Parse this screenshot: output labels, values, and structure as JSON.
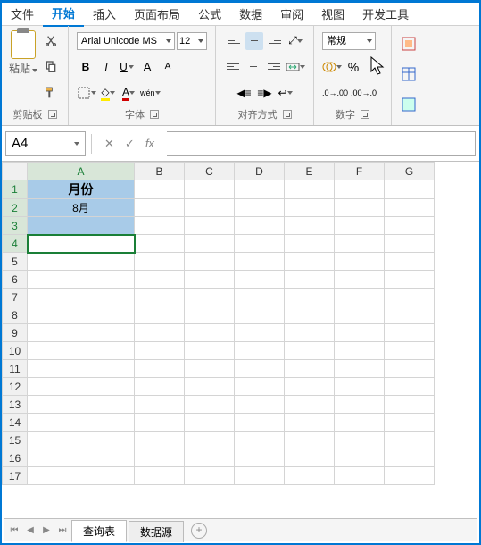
{
  "menu": {
    "items": [
      "文件",
      "开始",
      "插入",
      "页面布局",
      "公式",
      "数据",
      "审阅",
      "视图",
      "开发工具"
    ],
    "active_index": 1
  },
  "ribbon": {
    "clipboard": {
      "paste": "粘贴",
      "label": "剪贴板"
    },
    "font": {
      "name": "Arial Unicode MS",
      "size": "12",
      "bold": "B",
      "italic": "I",
      "underline": "U",
      "grow": "A",
      "shrink": "A",
      "wen": "wén",
      "label": "字体"
    },
    "align": {
      "label": "对齐方式"
    },
    "number": {
      "format": "常规",
      "label": "数字"
    }
  },
  "namebox": "A4",
  "fx": {
    "cancel": "✕",
    "confirm": "✓",
    "fx": "fx"
  },
  "columns": [
    "A",
    "B",
    "C",
    "D",
    "E",
    "F",
    "G"
  ],
  "rows": [
    1,
    2,
    3,
    4,
    5,
    6,
    7,
    8,
    9,
    10,
    11,
    12,
    13,
    14,
    15,
    16,
    17
  ],
  "cells": {
    "A1": "月份",
    "A2": "8月"
  },
  "sheets": {
    "tabs": [
      "查询表",
      "数据源"
    ],
    "active_index": 0,
    "add": "+"
  },
  "chart_data": {
    "type": "table",
    "columns": [
      "月份"
    ],
    "rows": [
      [
        "8月"
      ]
    ]
  }
}
